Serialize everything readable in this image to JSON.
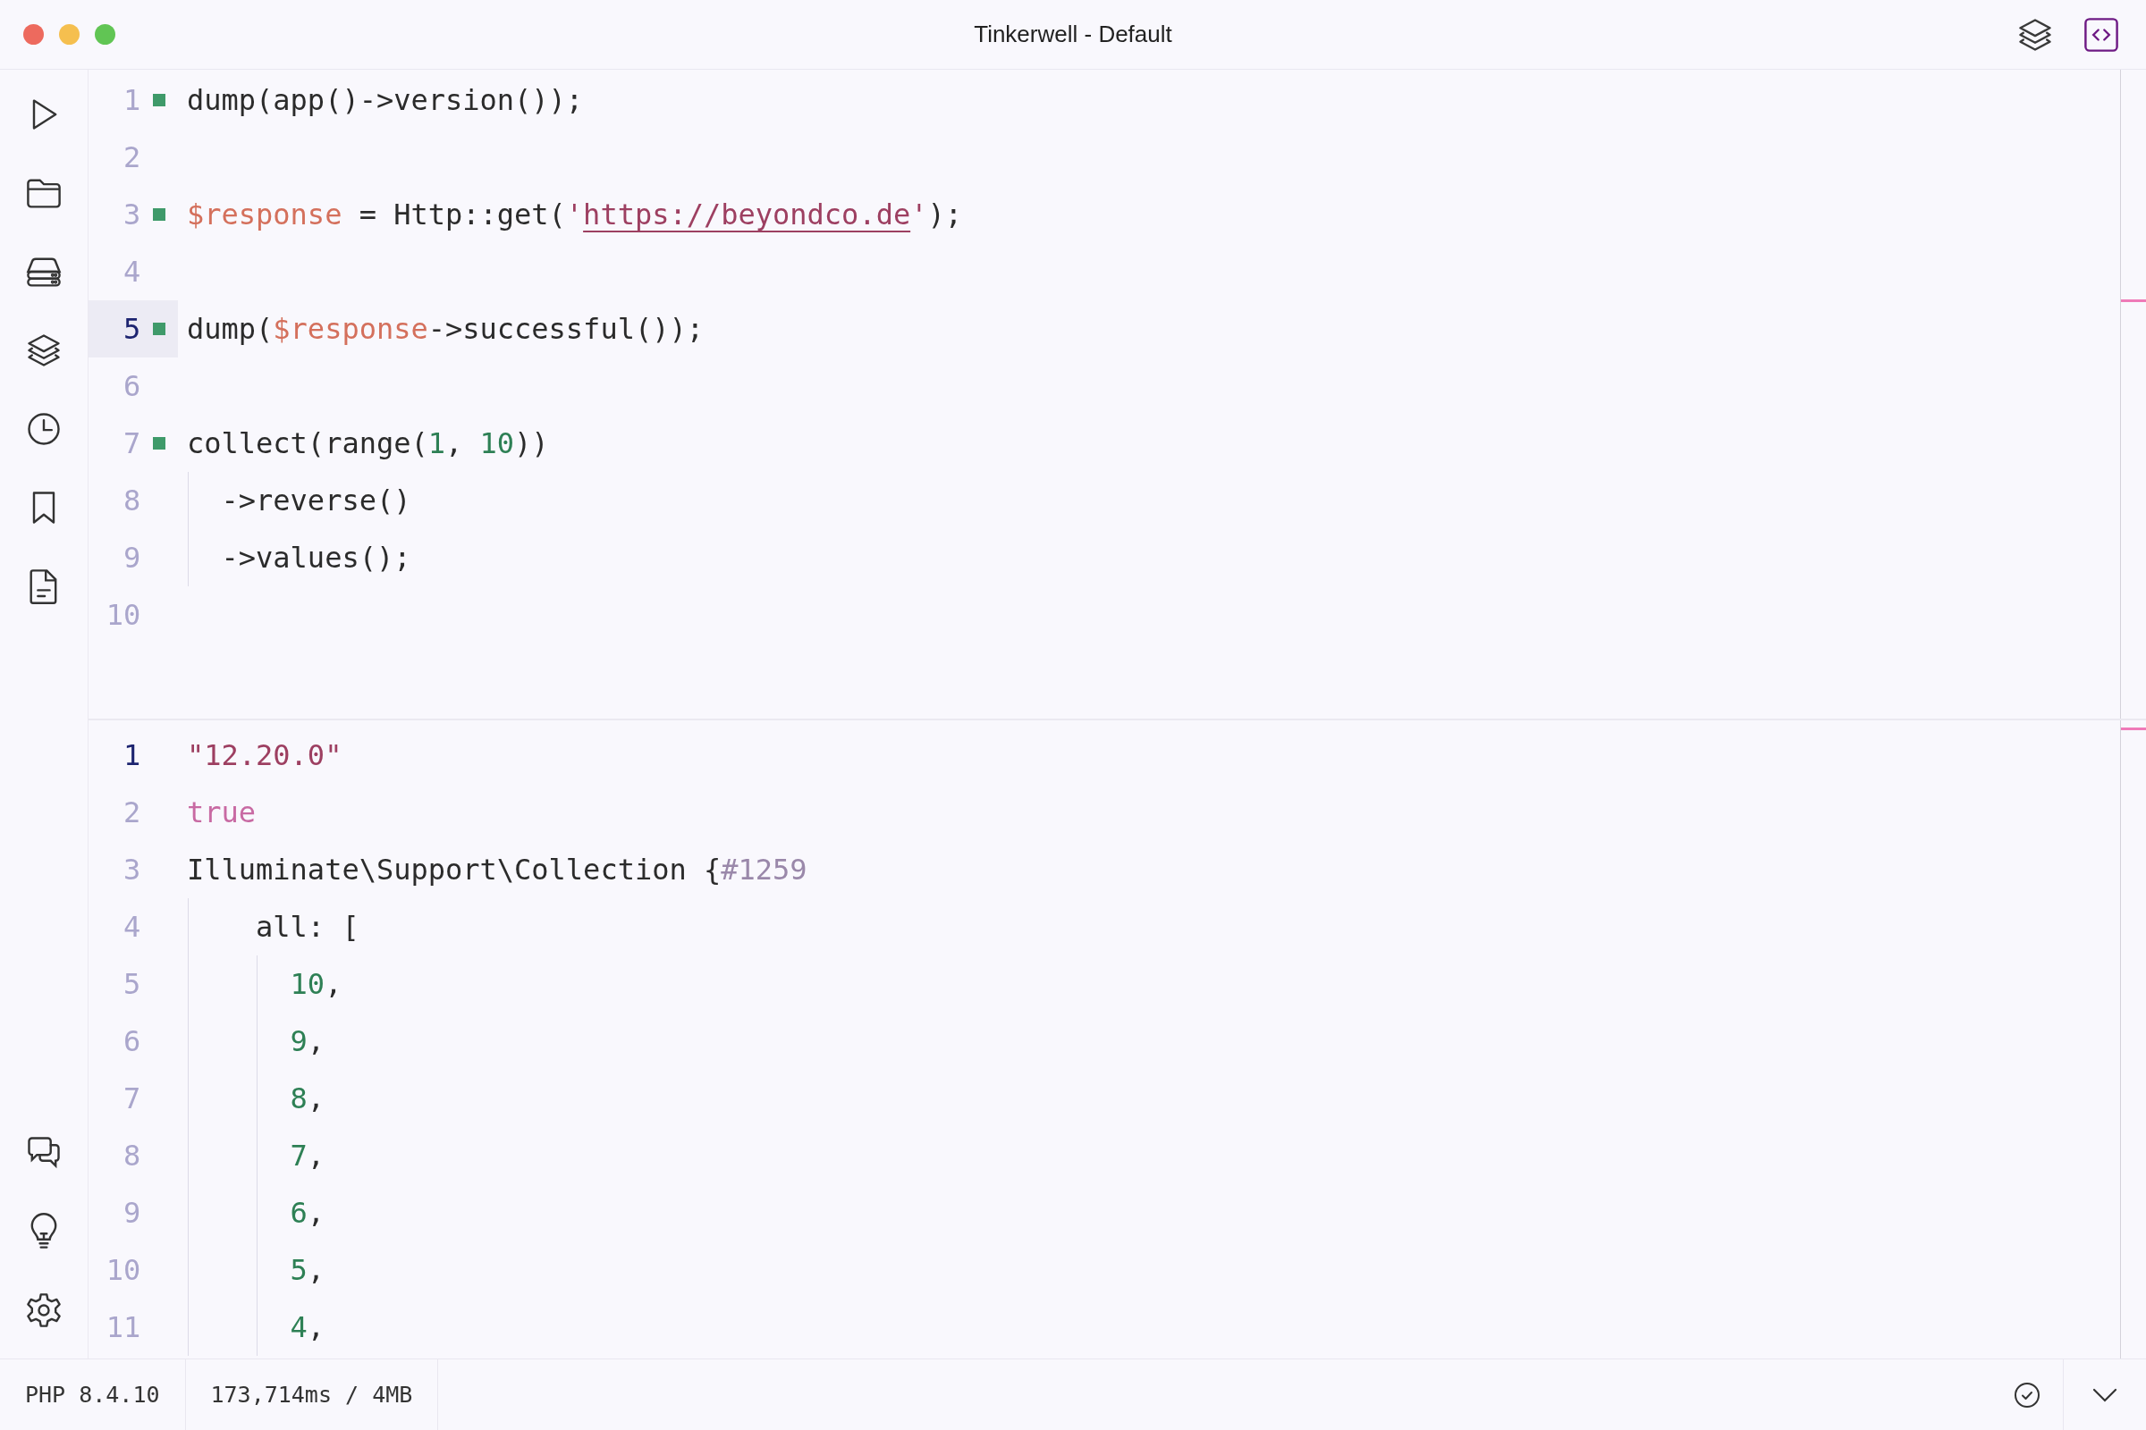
{
  "window": {
    "title": "Tinkerwell - Default"
  },
  "title_bar_actions": [
    {
      "kind": "layers",
      "selected": false
    },
    {
      "kind": "code",
      "selected": true
    }
  ],
  "sidebar": {
    "top_items": [
      {
        "kind": "run"
      },
      {
        "kind": "folder"
      },
      {
        "kind": "server"
      },
      {
        "kind": "layers"
      },
      {
        "kind": "history"
      },
      {
        "kind": "bookmark"
      },
      {
        "kind": "document"
      }
    ],
    "bottom_items": [
      {
        "kind": "chat"
      },
      {
        "kind": "lightbulb"
      },
      {
        "kind": "settings"
      }
    ]
  },
  "editor": {
    "lines": [
      {
        "number": "1",
        "executed": true,
        "active": false,
        "tokens": [
          {
            "kind": "plain",
            "text": "dump(app()->version());"
          }
        ]
      },
      {
        "number": "2",
        "executed": false,
        "active": false
      },
      {
        "number": "3",
        "executed": true,
        "active": false,
        "tokens": [
          {
            "kind": "variable",
            "text": "$response"
          },
          {
            "kind": "plain",
            "text": " = Http::get("
          },
          {
            "kind": "string",
            "text": "'"
          },
          {
            "kind": "url",
            "text": "https://beyondco.de"
          },
          {
            "kind": "string",
            "text": "'"
          },
          {
            "kind": "plain",
            "text": ");"
          }
        ]
      },
      {
        "number": "4",
        "executed": false,
        "active": false
      },
      {
        "number": "5",
        "executed": true,
        "active": true,
        "tokens": [
          {
            "kind": "plain",
            "text": "dump("
          },
          {
            "kind": "variable",
            "text": "$response"
          },
          {
            "kind": "plain",
            "text": "->successful());"
          }
        ]
      },
      {
        "number": "6",
        "executed": false,
        "active": false
      },
      {
        "number": "7",
        "executed": true,
        "active": false,
        "tokens": [
          {
            "kind": "plain",
            "text": "collect(range("
          },
          {
            "kind": "number",
            "text": "1"
          },
          {
            "kind": "plain",
            "text": ", "
          },
          {
            "kind": "number",
            "text": "10"
          },
          {
            "kind": "plain",
            "text": "))"
          }
        ]
      },
      {
        "number": "8",
        "executed": false,
        "active": false,
        "tokens": [
          {
            "kind": "plain",
            "text": "  ->reverse()"
          }
        ]
      },
      {
        "number": "9",
        "executed": false,
        "active": false,
        "tokens": [
          {
            "kind": "plain",
            "text": "  ->values();"
          }
        ]
      },
      {
        "number": "10",
        "executed": false,
        "active": false
      }
    ]
  },
  "output": {
    "lines": [
      {
        "number": "1",
        "active": true,
        "tokens": [
          {
            "kind": "string",
            "text": "\"12.20.0\""
          }
        ]
      },
      {
        "number": "2",
        "active": false,
        "tokens": [
          {
            "kind": "bool",
            "text": "true"
          }
        ]
      },
      {
        "number": "3",
        "active": false,
        "tokens": [
          {
            "kind": "plain",
            "text": "Illuminate\\Support\\Collection {"
          },
          {
            "kind": "hash",
            "text": "#1259"
          }
        ]
      },
      {
        "number": "4",
        "active": false,
        "tokens": [
          {
            "kind": "plain",
            "text": "    all: ["
          }
        ]
      },
      {
        "number": "5",
        "active": false,
        "tokens": [
          {
            "kind": "number",
            "text": "      10"
          },
          {
            "kind": "plain",
            "text": ","
          }
        ]
      },
      {
        "number": "6",
        "active": false,
        "tokens": [
          {
            "kind": "number",
            "text": "      9"
          },
          {
            "kind": "plain",
            "text": ","
          }
        ]
      },
      {
        "number": "7",
        "active": false,
        "tokens": [
          {
            "kind": "number",
            "text": "      8"
          },
          {
            "kind": "plain",
            "text": ","
          }
        ]
      },
      {
        "number": "8",
        "active": false,
        "tokens": [
          {
            "kind": "number",
            "text": "      7"
          },
          {
            "kind": "plain",
            "text": ","
          }
        ]
      },
      {
        "number": "9",
        "active": false,
        "tokens": [
          {
            "kind": "number",
            "text": "      6"
          },
          {
            "kind": "plain",
            "text": ","
          }
        ]
      },
      {
        "number": "10",
        "active": false,
        "tokens": [
          {
            "kind": "number",
            "text": "      5"
          },
          {
            "kind": "plain",
            "text": ","
          }
        ]
      },
      {
        "number": "11",
        "active": false,
        "tokens": [
          {
            "kind": "number",
            "text": "      4"
          },
          {
            "kind": "plain",
            "text": ","
          }
        ]
      }
    ]
  },
  "status_bar": {
    "php_version": "PHP 8.4.10",
    "stats": "173,714ms / 4MB"
  }
}
